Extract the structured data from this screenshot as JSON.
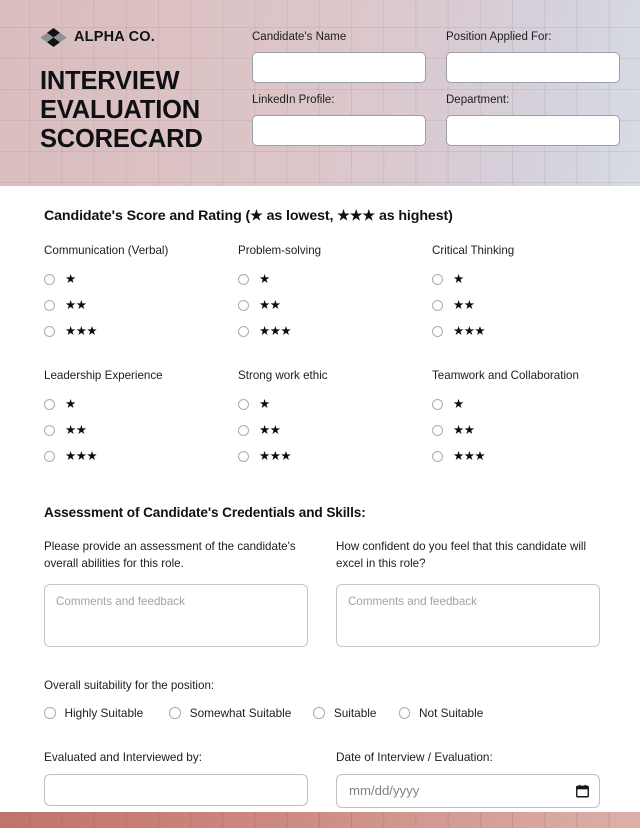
{
  "header": {
    "brand_name": "ALPHA CO.",
    "logo_icon": "diamond-logo-icon",
    "title": "INTERVIEW EVALUATION SCORECARD",
    "title_line1": "INTERVIEW",
    "title_line2": "EVALUATION",
    "title_line3": "SCORECARD",
    "fields": [
      {
        "label": "Candidate's Name",
        "value": "",
        "placeholder": ""
      },
      {
        "label": "Position Applied For:",
        "value": "",
        "placeholder": ""
      },
      {
        "label": "LinkedIn Profile:",
        "value": "",
        "placeholder": ""
      },
      {
        "label": "Department:",
        "value": "",
        "placeholder": ""
      }
    ]
  },
  "rating_section": {
    "heading": "Candidate's Score and Rating (★ as lowest, ★★★ as highest)",
    "options": [
      "★",
      "★★",
      "★★★"
    ],
    "categories": [
      {
        "label": "Communication (Verbal)",
        "selected": null
      },
      {
        "label": "Problem-solving",
        "selected": null
      },
      {
        "label": "Critical Thinking",
        "selected": null
      },
      {
        "label": "Leadership Experience",
        "selected": null
      },
      {
        "label": "Strong work ethic",
        "selected": null
      },
      {
        "label": "Teamwork and Collaboration",
        "selected": null
      }
    ]
  },
  "assessment_section": {
    "heading": "Assessment of Candidate's Credentials and Skills:",
    "prompts": [
      {
        "text": "Please provide an assessment of the candidate's overall abilities for this role.",
        "value": "",
        "placeholder": "Comments and feedback"
      },
      {
        "text": "How confident do you feel that this candidate will excel in this role?",
        "value": "",
        "placeholder": "Comments and feedback"
      }
    ]
  },
  "suitability": {
    "label": "Overall suitability for the position:",
    "options": [
      {
        "label": "Highly Suitable",
        "selected": false
      },
      {
        "label": "Somewhat Suitable",
        "selected": false
      },
      {
        "label": "Suitable",
        "selected": false
      },
      {
        "label": "Not Suitable",
        "selected": false
      }
    ]
  },
  "footer_fields": {
    "evaluator": {
      "label": "Evaluated and Interviewed by:",
      "value": "",
      "placeholder": ""
    },
    "date": {
      "label": "Date of Interview / Evaluation:",
      "value": "",
      "placeholder": "mm/dd/yyyy",
      "icon": "calendar-icon"
    }
  },
  "colors": {
    "header_gradient_start": "#d9bdbf",
    "header_gradient_end": "#d7dce5",
    "footer_gradient_start": "#c2736a",
    "footer_gradient_end": "#dcb0aa",
    "text": "#14161a",
    "placeholder": "#9ea3a9"
  }
}
